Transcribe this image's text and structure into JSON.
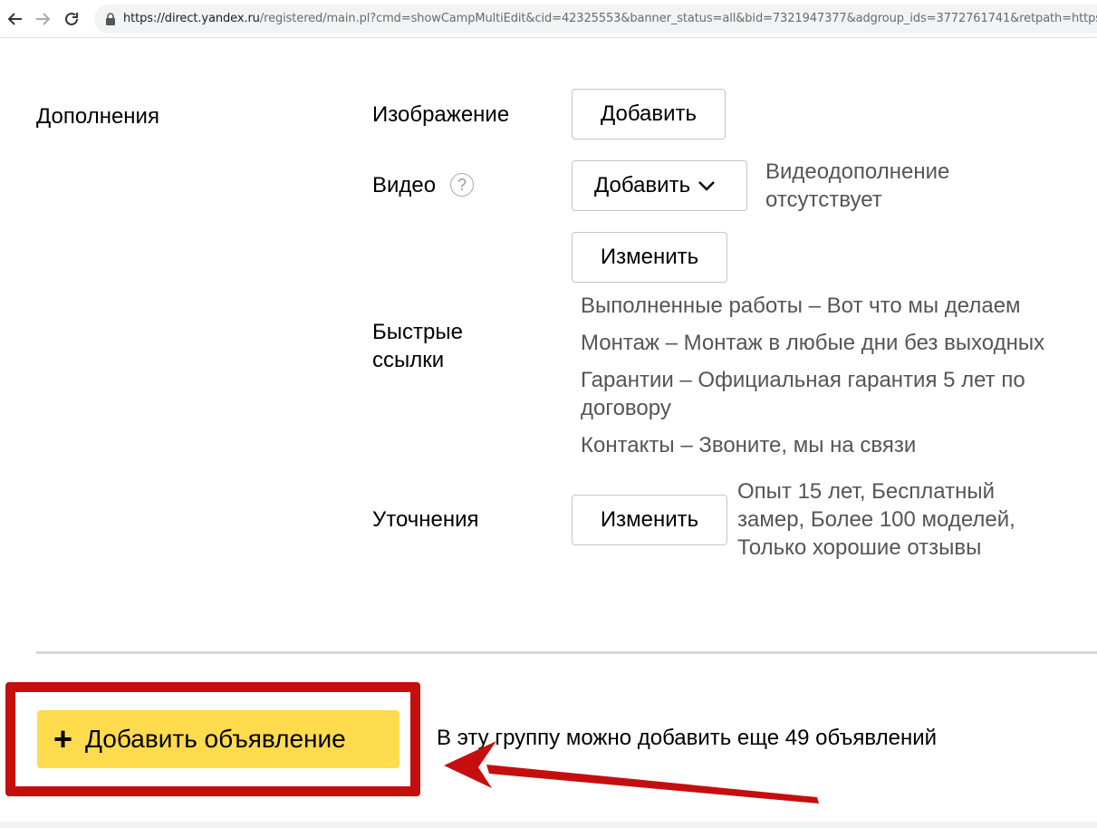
{
  "browser": {
    "url_host": "https://direct.yandex.ru",
    "url_path": "/registered/main.pl?cmd=showCampMultiEdit&cid=42325553&banner_status=all&bid=7321947377&adgroup_ids=3772761741&retpath=https%3A%2"
  },
  "extras": {
    "section_title": "Дополнения",
    "image": {
      "label": "Изображение",
      "button": "Добавить"
    },
    "video": {
      "label": "Видео",
      "help": "?",
      "button": "Добавить",
      "status_line1": "Видеодополнение",
      "status_line2": "отсутствует"
    },
    "quick_links": {
      "label_line1": "Быстрые",
      "label_line2": "ссылки",
      "button": "Изменить",
      "items": [
        "Выполненные работы – Вот что мы делаем",
        "Монтаж – Монтаж в любые дни без выходных",
        "Гарантии – Официальная гарантия 5 лет по",
        "договору",
        "Контакты – Звоните, мы на связи"
      ]
    },
    "callouts": {
      "label": "Уточнения",
      "button": "Изменить",
      "text_line1": "Опыт 15 лет, Бесплатный",
      "text_line2": "замер, Более 100 моделей,",
      "text_line3": "Только хорошие отзывы"
    }
  },
  "footer": {
    "add_ad_plus": "+",
    "add_ad_label": "Добавить объявление",
    "hint": "В эту группу можно добавить еще 49 объявлений"
  },
  "colors": {
    "accent_yellow": "#ffdb4d",
    "highlight_red": "#c50f0f"
  }
}
